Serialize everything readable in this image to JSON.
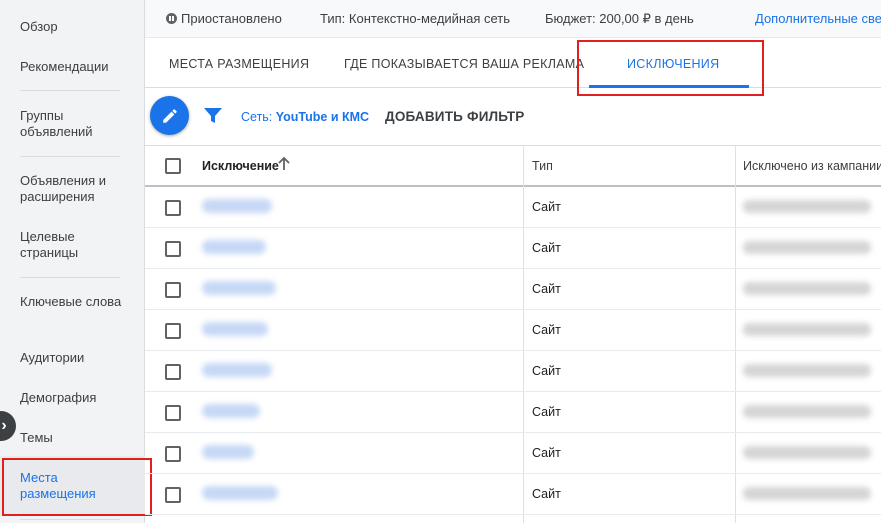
{
  "sidebar": {
    "items": [
      {
        "label": "Обзор"
      },
      {
        "label": "Рекомендации"
      },
      {
        "label": "Группы объявлений"
      },
      {
        "label": "Объявления и расширения"
      },
      {
        "label": "Целевые страницы"
      },
      {
        "label": "Ключевые слова"
      },
      {
        "label": "Аудитории"
      },
      {
        "label": "Демография"
      },
      {
        "label": "Темы"
      },
      {
        "label": "Места размещения"
      }
    ],
    "active_item": "Места размещения",
    "collapse_glyph": "›"
  },
  "status": {
    "state": "Приостановлено",
    "type": "Тип: Контекстно-медийная сеть",
    "budget": "Бюджет: 200,00 ₽ в день",
    "more_link": "Дополнительные све"
  },
  "tabs": [
    {
      "label": "МЕСТА РАЗМЕЩЕНИЯ"
    },
    {
      "label": "ГДЕ ПОКАЗЫВАЕТСЯ ВАША РЕКЛАМА"
    },
    {
      "label": "ИСКЛЮЧЕНИЯ"
    }
  ],
  "active_tab": "ИСКЛЮЧЕНИЯ",
  "filter": {
    "network_prefix": "Сеть: ",
    "network_value": "YouTube и КМС",
    "add_filter": "ДОБАВИТЬ ФИЛЬТР"
  },
  "table": {
    "columns": [
      "Исключение",
      "Тип",
      "Исключено из кампании"
    ],
    "sort_column": "Исключение",
    "rows": [
      {
        "type": "Сайт"
      },
      {
        "type": "Сайт"
      },
      {
        "type": "Сайт"
      },
      {
        "type": "Сайт"
      },
      {
        "type": "Сайт"
      },
      {
        "type": "Сайт"
      },
      {
        "type": "Сайт"
      },
      {
        "type": "Сайт"
      }
    ]
  },
  "colors": {
    "accent": "#1a73e8",
    "highlight": "#e0201f",
    "sidebar_bg": "#f1f3f4"
  },
  "icons": {
    "fab": "pencil-icon",
    "filter": "filter-funnel-icon",
    "sort": "arrow-up-icon",
    "status": "pause-circle-icon",
    "collapse": "chevron-right-icon"
  }
}
